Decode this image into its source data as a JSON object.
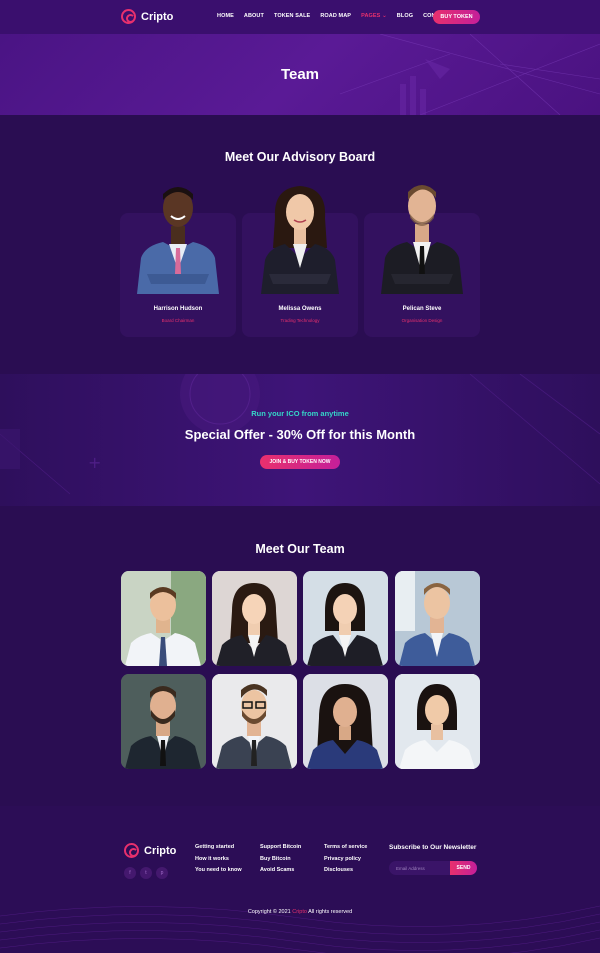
{
  "header": {
    "logo_text": "Cripto",
    "nav": [
      "HOME",
      "ABOUT",
      "TOKEN SALE",
      "ROAD MAP",
      "PAGES",
      "BLOG",
      "CONTACT"
    ],
    "nav_active": "PAGES",
    "cta": "BUY TOKEN"
  },
  "hero": {
    "title": "Team"
  },
  "advisory": {
    "title": "Meet Our Advisory Board",
    "members": [
      {
        "name": "Harrison Hudson",
        "role": "Board Chairman"
      },
      {
        "name": "Melissa Owens",
        "role": "Trading Technology"
      },
      {
        "name": "Pelican Steve",
        "role": "Organisation Design"
      }
    ]
  },
  "offer": {
    "subtitle": "Run your ICO from anytime",
    "title": "Special Offer - 30% Off for this Month",
    "button": "JOIN & BUY TOKEN NOW"
  },
  "team": {
    "title": "Meet Our Team",
    "count": 8
  },
  "footer": {
    "logo_text": "Cripto",
    "social_icons": [
      "facebook-icon",
      "twitter-icon",
      "pinterest-icon"
    ],
    "col1": [
      "Getting started",
      "How it works",
      "You need to know"
    ],
    "col2": [
      "Support Bitcoin",
      "Buy Bitcoin",
      "Avoid Scams"
    ],
    "col3": [
      "Terms of service",
      "Privacy policy",
      "Disclouses"
    ],
    "newsletter_title": "Subscribe to Our Newsletter",
    "newsletter_placeholder": "Email Address",
    "newsletter_button": "SEND",
    "copyright_prefix": "Copyright © 2021",
    "copyright_brand": "Cripto",
    "copyright_suffix": "All rights reserved"
  },
  "colors": {
    "accent": "#e8306d",
    "teal": "#35d6c8",
    "bg": "#2a0d52"
  }
}
